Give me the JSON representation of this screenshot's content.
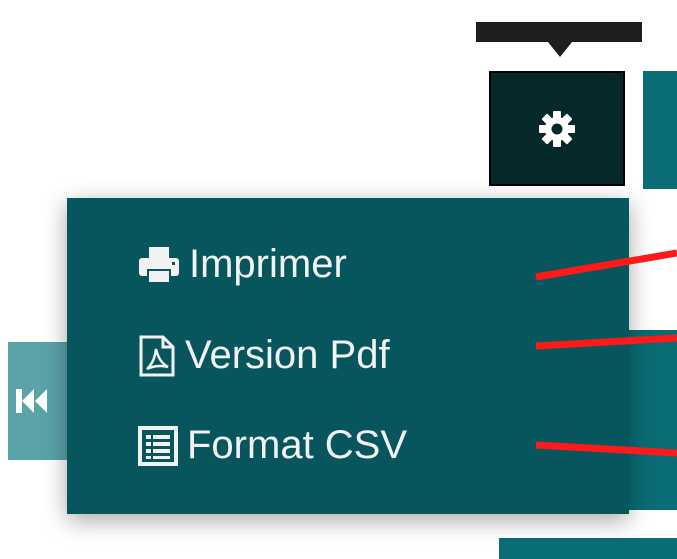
{
  "menu": {
    "items": [
      {
        "label": "Imprimer",
        "icon": "printer-icon"
      },
      {
        "label": "Version Pdf",
        "icon": "pdf-file-icon"
      },
      {
        "label": "Format CSV",
        "icon": "csv-list-icon"
      }
    ]
  },
  "settings_button": {
    "icon": "gear-icon"
  },
  "navigation": {
    "first_page_icon": "fast-backward-icon"
  },
  "colors": {
    "menu_background": "#08565d",
    "gear_button_background": "#05292b",
    "teal_accent": "#0a6c74",
    "annotation_line": "#ff1a1a",
    "menu_text": "#f2f2f2"
  }
}
